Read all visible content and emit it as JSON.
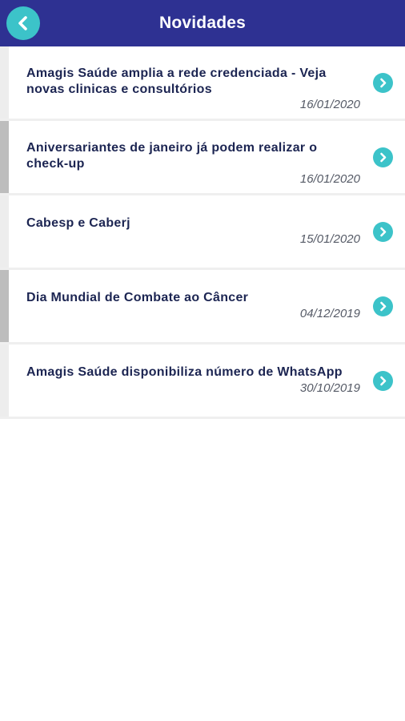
{
  "header": {
    "title": "Novidades",
    "back_icon": "chevron-left-icon"
  },
  "colors": {
    "header_bg": "#2e3192",
    "accent": "#3cc3c9",
    "title_text": "#1c2552",
    "date_text": "#555a66"
  },
  "news": [
    {
      "title": "Amagis Saúde amplia a rede credenciada - Veja novas clinicas e consultórios",
      "date": "16/01/2020"
    },
    {
      "title": "Aniversariantes de janeiro já podem realizar o check-up",
      "date": "16/01/2020"
    },
    {
      "title": "Cabesp e Caberj",
      "date": "15/01/2020"
    },
    {
      "title": "Dia Mundial de Combate ao Câncer",
      "date": "04/12/2019"
    },
    {
      "title": "Amagis Saúde disponibiliza número de WhatsApp",
      "date": "30/10/2019"
    }
  ]
}
